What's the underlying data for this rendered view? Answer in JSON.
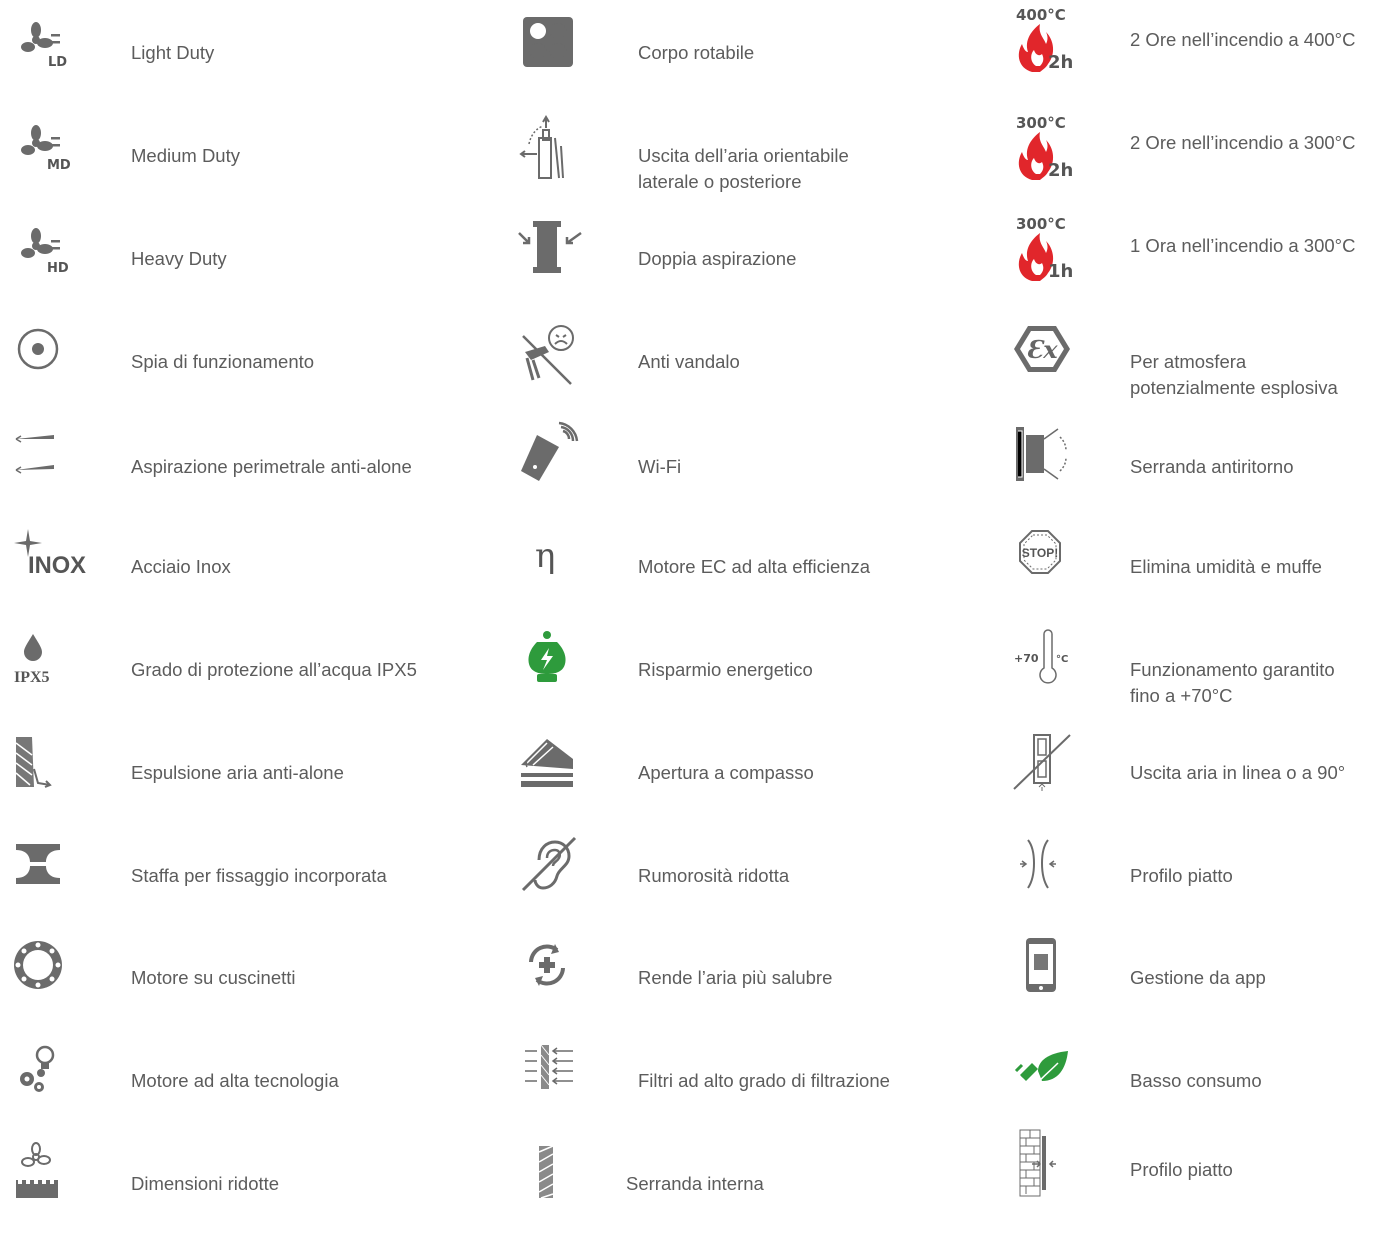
{
  "columns": [
    {
      "items": [
        {
          "icon": "fan-light-duty-icon",
          "badge": "LD",
          "label": "Light Duty"
        },
        {
          "icon": "fan-medium-duty-icon",
          "badge": "MD",
          "label": "Medium Duty"
        },
        {
          "icon": "fan-heavy-duty-icon",
          "badge": "HD",
          "label": "Heavy Duty"
        },
        {
          "icon": "indicator-light-icon",
          "label": "Spia di funzionamento"
        },
        {
          "icon": "perimeter-intake-icon",
          "label": "Aspirazione perimetrale anti-alone"
        },
        {
          "icon": "stainless-steel-icon",
          "badge": "INOX",
          "label": "Acciaio Inox"
        },
        {
          "icon": "water-drop-icon",
          "badge": "IPX5",
          "label": "Grado di protezione all’acqua IPX5"
        },
        {
          "icon": "air-expulsion-icon",
          "label": "Espulsione aria anti-alone"
        },
        {
          "icon": "mounting-bracket-icon",
          "label": "Staffa per fissaggio incorporata"
        },
        {
          "icon": "bearing-ring-icon",
          "label": "Motore su cuscinetti"
        },
        {
          "icon": "gears-bulb-icon",
          "label": "Motore ad alta tecnologia"
        },
        {
          "icon": "compact-fan-icon",
          "label": "Dimensioni ridotte"
        }
      ]
    },
    {
      "items": [
        {
          "icon": "rotating-body-icon",
          "label": "Corpo rotabile"
        },
        {
          "icon": "adjustable-outlet-icon",
          "label": "Uscita dell’aria orientabile\nlaterale o posteriore"
        },
        {
          "icon": "double-intake-icon",
          "label": "Doppia aspirazione"
        },
        {
          "icon": "anti-vandal-icon",
          "label": "Anti vandalo"
        },
        {
          "icon": "wifi-remote-icon",
          "label": "Wi-Fi"
        },
        {
          "icon": "eta-icon",
          "badge": "η",
          "label": "Motore EC ad alta efficienza"
        },
        {
          "icon": "energy-saving-icon",
          "label": "Risparmio energetico"
        },
        {
          "icon": "compass-opening-icon",
          "label": "Apertura a compasso"
        },
        {
          "icon": "reduced-noise-icon",
          "label": "Rumorosità ridotta"
        },
        {
          "icon": "healthy-air-icon",
          "label": "Rende l’aria più salubre"
        },
        {
          "icon": "filter-icon",
          "label": "Filtri ad alto grado di filtrazione"
        },
        {
          "icon": "internal-damper-icon",
          "label": "Serranda interna"
        }
      ]
    },
    {
      "items": [
        {
          "icon": "fire-400-2h-icon",
          "temp": "400°C",
          "duration": "2h",
          "label": "2 Ore nell’incendio a 400°C"
        },
        {
          "icon": "fire-300-2h-icon",
          "temp": "300°C",
          "duration": "2h",
          "label": "2 Ore nell’incendio a 300°C"
        },
        {
          "icon": "fire-300-1h-icon",
          "temp": "300°C",
          "duration": "1h",
          "label": "1 Ora nell’incendio a 300°C"
        },
        {
          "icon": "explosive-atmosphere-icon",
          "badge": "Ɛx",
          "label": "Per atmosfera\npotenzialmente esplosiva"
        },
        {
          "icon": "backdraft-damper-icon",
          "label": "Serranda antiritorno"
        },
        {
          "icon": "stop-mold-icon",
          "badge": "STOP!",
          "label": "Elimina umidità e muffe"
        },
        {
          "icon": "thermometer-icon",
          "badge": "+70",
          "unit": "°C",
          "label": "Funzionamento garantito\nfino a +70°C"
        },
        {
          "icon": "inline-outlet-icon",
          "label": "Uscita aria in linea o a 90°"
        },
        {
          "icon": "flat-profile-icon",
          "label": "Profilo piatto"
        },
        {
          "icon": "smartphone-app-icon",
          "label": "Gestione da app"
        },
        {
          "icon": "low-consumption-icon",
          "label": "Basso consumo"
        },
        {
          "icon": "flat-profile-wall-icon",
          "label": "Profilo piatto"
        }
      ]
    }
  ],
  "colors": {
    "text": "#5c5c5c",
    "icon": "#6b6b6b",
    "fire": "#e1262b",
    "eco": "#2e9b3c"
  }
}
